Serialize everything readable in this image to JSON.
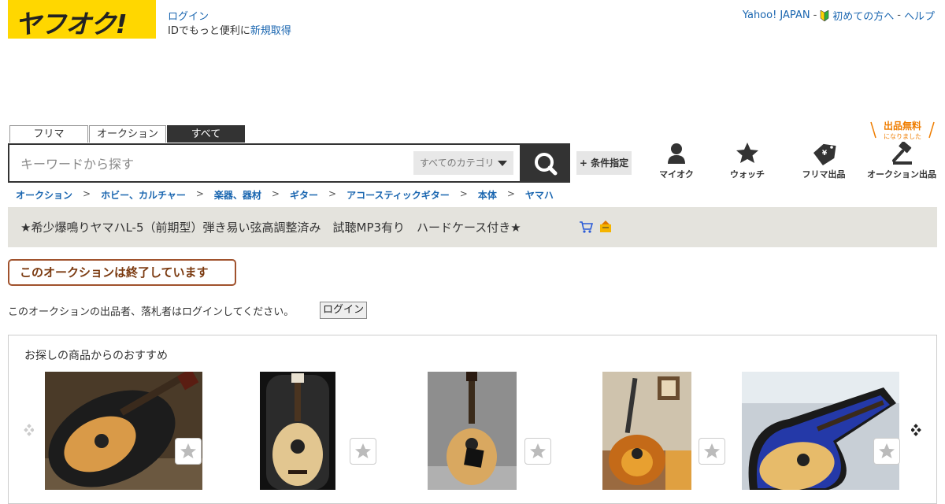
{
  "header": {
    "logo_text": "ヤフオク!",
    "login_label": "ログイン",
    "login_note_prefix": "IDでもっと便利に",
    "register_label": "新規取得",
    "links": {
      "yahoo_japan": "Yahoo! JAPAN",
      "separator": "-",
      "beginners": "初めての方へ",
      "help": "ヘルプ"
    }
  },
  "search": {
    "tabs": [
      "フリマ",
      "オークション",
      "すべて"
    ],
    "active_tab": "すべて",
    "placeholder": "キーワードから探す",
    "category_value": "すべてのカテゴリ",
    "condition_button": "+ 条件指定"
  },
  "nav_icons": [
    {
      "label": "マイオク",
      "icon": "person-icon"
    },
    {
      "label": "ウォッチ",
      "icon": "star-icon"
    },
    {
      "label": "フリマ出品",
      "icon": "price-tag-icon"
    },
    {
      "label": "オークション出品",
      "icon": "gavel-icon"
    }
  ],
  "free_badge": {
    "main": "出品無料",
    "sub": "になりました"
  },
  "breadcrumb": [
    "オークション",
    "ホビー、カルチャー",
    "楽器、器材",
    "ギター",
    "アコースティックギター",
    "本体",
    "ヤマハ"
  ],
  "item": {
    "title": "★希少爆鳴りヤマハL-5（前期型）弾き易い弦高調整済み　試聴MP3有り　ハードケース付き★"
  },
  "status": {
    "ended_label": "このオークションは終了しています",
    "login_message": "このオークションの出品者、落札者はログインしてください。",
    "login_button": "ログイン"
  },
  "recommendations": {
    "title": "お探しの商品からのおすすめ",
    "items": [
      {
        "image": "acoustic-guitar-in-black-case"
      },
      {
        "image": "dreadnought-guitar-in-case-upright"
      },
      {
        "image": "acoustic-guitar-on-stand"
      },
      {
        "image": "sunburst-guitar-in-room"
      },
      {
        "image": "guitar-in-blue-lined-case"
      }
    ]
  },
  "colors": {
    "brand_yellow": "#ffd700",
    "link_blue": "#1a66b0",
    "dark": "#333333",
    "title_bar": "#e4e3dd",
    "ended_border": "#a0522d",
    "accent_orange": "#ef7d00"
  }
}
